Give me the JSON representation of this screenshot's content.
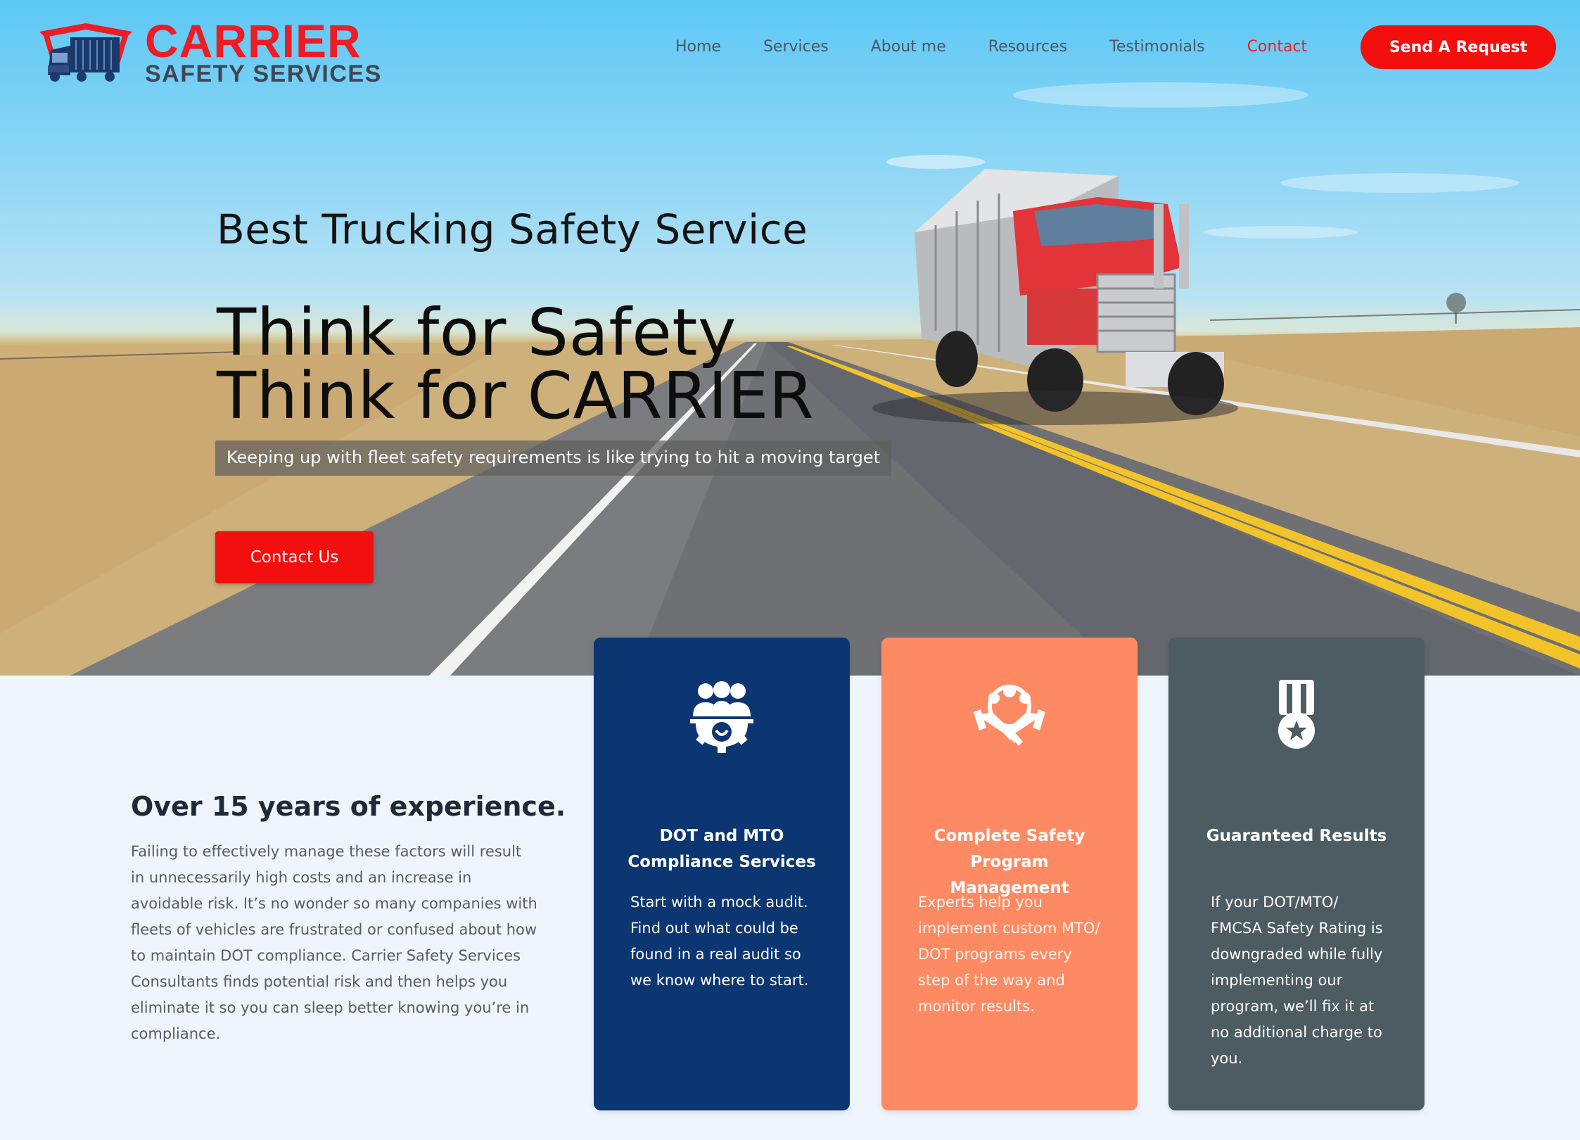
{
  "brand": {
    "name_top": "CARRIER",
    "name_bottom": "SAFETY SERVICES",
    "primary_color": "#ee1c25",
    "secondary_color": "#1b3a6b"
  },
  "nav": {
    "items": [
      {
        "label": "Home"
      },
      {
        "label": "Services"
      },
      {
        "label": "About me"
      },
      {
        "label": "Resources"
      },
      {
        "label": "Testimonials"
      },
      {
        "label": "Contact"
      }
    ],
    "active": "Contact",
    "cta_label": "Send A Request"
  },
  "hero": {
    "subtitle": "Best Trucking Safety Service",
    "title_line1": "Think for Safety",
    "title_line2": "Think for CARRIER",
    "tagline": "Keeping up with fleet safety requirements is like trying to hit a moving target",
    "cta_label": "Contact Us"
  },
  "experience": {
    "title": "Over 15 years of experience.",
    "body": "Failing to effectively manage these factors will result in unnecessarily high costs and an increase in avoidable risk. It’s no wonder so many companies with fleets of vehicles are frustrated or confused about how to maintain DOT compliance. Carrier Safety Services Consultants finds potential risk and then helps you eliminate it so you can sleep better knowing you’re in compliance."
  },
  "cards": [
    {
      "icon": "team-gear-icon",
      "title": "DOT and MTO Compliance Services",
      "body": "Start with a mock audit. Find out what could be found in a real audit so we know where to start.",
      "color": "#0b3672"
    },
    {
      "icon": "handshake-icon",
      "title": "Complete Safety Program Management",
      "body": "Experts help you implement custom MTO/ DOT programs every step of the way and monitor results.",
      "color": "#fe8a64"
    },
    {
      "icon": "medal-icon",
      "title": "Guaranteed Results",
      "body": "If your DOT/MTO/ FMCSA Safety Rating is downgraded while fully implementing our program, we’ll fix it at no additional charge to you.",
      "color": "#4d5c62"
    }
  ]
}
